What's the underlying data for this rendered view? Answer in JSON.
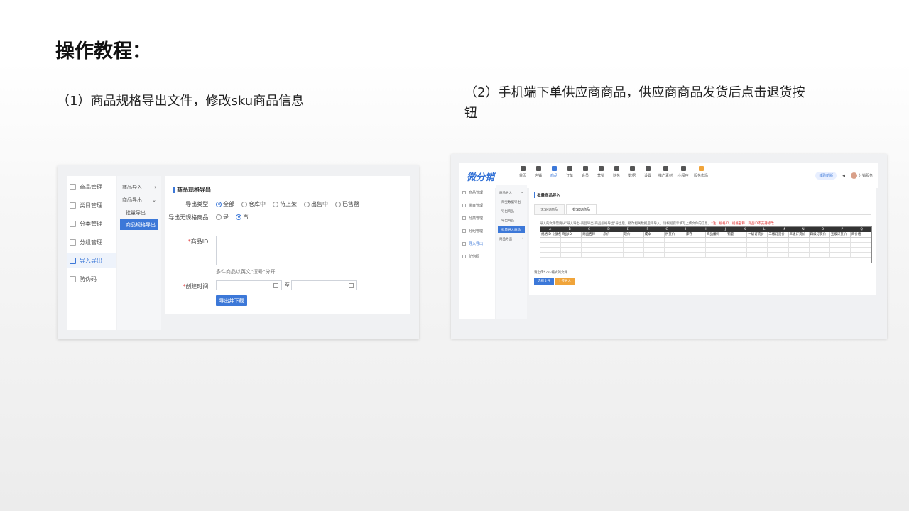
{
  "title": "操作教程：",
  "captions": {
    "step1": "（1）商品规格导出文件，修改sku商品信息",
    "step2": "（2）手机端下单供应商商品，供应商商品发货后点击退货按钮"
  },
  "shot1": {
    "nav": [
      "商品管理",
      "类目管理",
      "分类管理",
      "分组管理",
      "导入导出",
      "防伪码"
    ],
    "active_nav_index": 4,
    "sub": {
      "import": "商品导入",
      "export": "商品导出",
      "batch_export": "批量导出",
      "spec_export": "商品规格导出"
    },
    "heading": "商品规格导出",
    "export_type_label": "导出类型:",
    "export_type_options": [
      "全部",
      "仓库中",
      "待上架",
      "出售中",
      "已售罄"
    ],
    "no_spec_label": "导出无规格商品:",
    "no_spec_options": [
      "是",
      "否"
    ],
    "product_id_label": "商品ID:",
    "product_id_hint": "多件商品以英文\"逗号\"分开",
    "created_time_label": "创建时间:",
    "to_label": "至",
    "submit_button": "导出并下载"
  },
  "shot2": {
    "logo": "微分销",
    "menu": [
      "首页",
      "店铺",
      "商品",
      "订单",
      "会员",
      "营销",
      "财务",
      "数据",
      "设置",
      "推广素材",
      "小程序",
      "服务市场"
    ],
    "active_menu_index": 2,
    "top_right": {
      "pill": "体验新版",
      "user": "分销服务"
    },
    "nav": [
      "商品管理",
      "类目管理",
      "分类管理",
      "分组管理",
      "导入导出",
      "防伪码"
    ],
    "active_nav_index": 4,
    "sub": {
      "import": "商品导入",
      "sub1": "淘宝数据导出",
      "sub2": "导出商品",
      "sub3": "导出商品",
      "active": "批量导入商品",
      "export": "商品导出"
    },
    "heading": "批量商品导入",
    "tabs": [
      "无SKU商品",
      "有SKU商品"
    ],
    "active_tab_index": 1,
    "note": "导入的文件需要从\"导入导出-商品导出-商品规格导出\"导出后，修改相关数据后再导入，请根据提示填写上传文件的信息。",
    "note_red": "*注：规格ID、规格名称、商品ID不支持修改",
    "sheet_columns": [
      "A",
      "B",
      "C",
      "D",
      "E",
      "F",
      "G",
      "H",
      "I",
      "J",
      "K",
      "L",
      "M",
      "N",
      "O",
      "P",
      "Q"
    ],
    "sheet_headers": [
      "规格ID（规格名称",
      "商品ID",
      "商品名称",
      "原价",
      "现价",
      "成本",
      "供货价",
      "库存",
      "商品编码",
      "销量",
      "一级订货价",
      "二级订货价",
      "三级订货价",
      "四级订货价",
      "五级订货价",
      "商价格"
    ],
    "upload_hint": "请上传*.csv格式的文件",
    "select_button": "选择文件",
    "upload_button": "上传导入"
  }
}
